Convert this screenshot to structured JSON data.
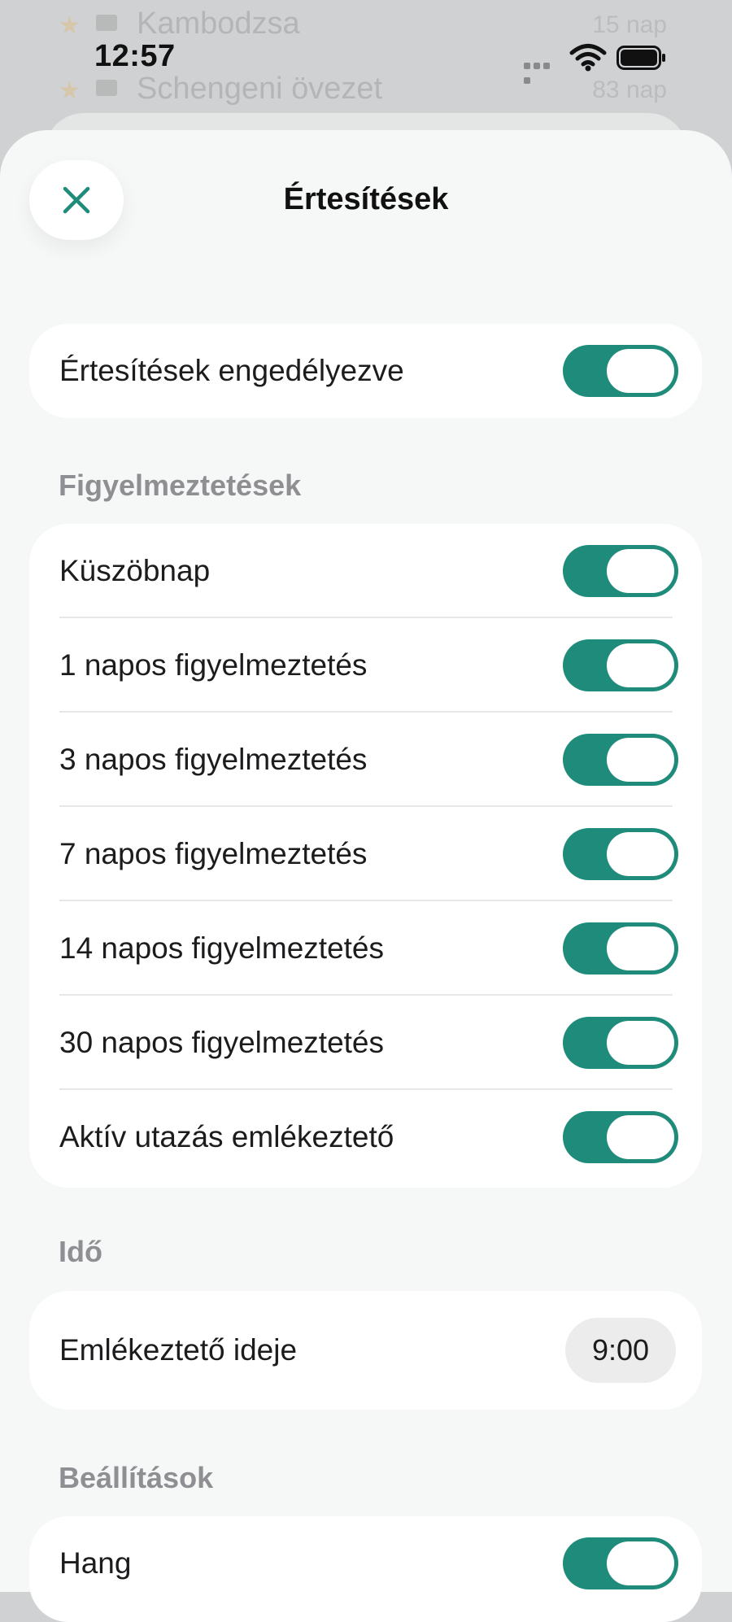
{
  "background_app": {
    "rows": [
      {
        "name": "Kambodzsa",
        "days": "15 nap"
      },
      {
        "name": "Schengeni övezet",
        "days": "83 nap"
      }
    ]
  },
  "status_bar": {
    "time": "12:57",
    "icons": [
      "signal-dots-icon",
      "wifi-icon",
      "battery-icon"
    ]
  },
  "sheet": {
    "title": "Értesítések",
    "close_icon": "close-icon"
  },
  "main_toggle": {
    "label": "Értesítések engedélyezve",
    "on": true
  },
  "sections": {
    "alerts": {
      "header": "Figyelmeztetések",
      "items": [
        {
          "label": "Küszöbnap",
          "on": true
        },
        {
          "label": "1 napos figyelmeztetés",
          "on": true
        },
        {
          "label": "3 napos figyelmeztetés",
          "on": true
        },
        {
          "label": "7 napos figyelmeztetés",
          "on": true
        },
        {
          "label": "14 napos figyelmeztetés",
          "on": true
        },
        {
          "label": "30 napos figyelmeztetés",
          "on": true
        },
        {
          "label": "Aktív utazás emlékeztető",
          "on": true
        }
      ]
    },
    "time": {
      "header": "Idő",
      "reminder_label": "Emlékeztető ideje",
      "reminder_value": "9:00"
    },
    "settings": {
      "header": "Beállítások",
      "sound_label": "Hang",
      "sound_on": true
    }
  },
  "colors": {
    "accent": "#1f8b7a",
    "sheet_background": "#f6f7f7",
    "section_header": "#8e8e93"
  }
}
